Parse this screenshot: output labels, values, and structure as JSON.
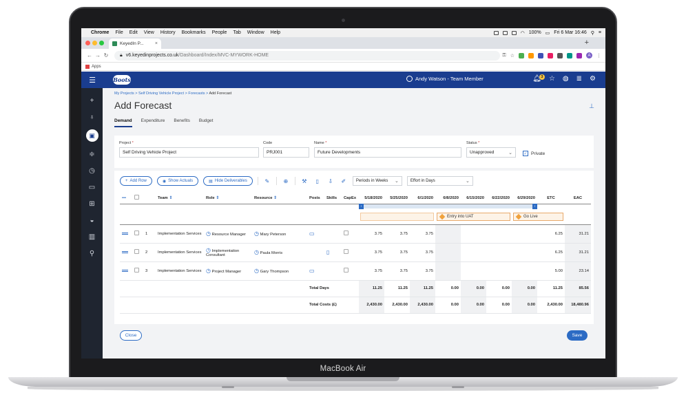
{
  "device_label": "MacBook Air",
  "menubar": {
    "items": [
      "Chrome",
      "File",
      "Edit",
      "View",
      "History",
      "Bookmarks",
      "People",
      "Tab",
      "Window",
      "Help"
    ],
    "battery": "100%",
    "clock": "Fri 6 Mar 16:46"
  },
  "browser": {
    "tab_title": "KeyedIn P...",
    "url_host": "v6.keyedinprojects.co.uk",
    "url_path": "/Dashboard/Index/MVC-MYWORK-HOME",
    "bookmark_apps": "Apps",
    "profile_initial": "A"
  },
  "header": {
    "logo": "Boots",
    "user": "Andy Watson - Team Member",
    "notification_count": "3"
  },
  "breadcrumb": {
    "items": [
      "My Projects",
      "Self Driving Vehicle Project",
      "Forecasts"
    ],
    "current": "Add Forecast"
  },
  "page_title": "Add Forecast",
  "tabs": [
    "Demand",
    "Expenditure",
    "Benefits",
    "Budget"
  ],
  "form": {
    "project_label": "Project",
    "project_value": "Self Driving Vehicle Project",
    "code_label": "Code",
    "code_value": "PRJ001",
    "name_label": "Name",
    "name_value": "Future Developments",
    "status_label": "Status",
    "status_value": "Unapproved",
    "private_label": "Private",
    "required_mark": "*",
    "check_mark": "✓"
  },
  "toolbar": {
    "add_row": "Add Row",
    "show_actuals": "Show Actuals",
    "hide_deliverables": "Hide Deliverables",
    "periods": "Periods in Weeks",
    "effort": "Effort in Days"
  },
  "grid": {
    "headers": {
      "team": "Team",
      "role": "Role",
      "resource": "Resource",
      "posts": "Posts",
      "skills": "Skills",
      "capex": "CapEx",
      "weeks": [
        "5/18/2020",
        "5/25/2020",
        "6/1/2020",
        "6/8/2020",
        "6/15/2020",
        "6/22/2020",
        "6/29/2020"
      ],
      "etc": "ETC",
      "eac": "EAC"
    },
    "milestones": [
      "Entry into UAT",
      "Go Live"
    ],
    "rows": [
      {
        "num": "1",
        "team": "Implementation Services",
        "role": "Resource Manager",
        "resource": "Mary Peterson",
        "weeks": [
          "3.75",
          "3.75",
          "3.75",
          "",
          "",
          "",
          ""
        ],
        "etc": "6.25",
        "eac": "31.21"
      },
      {
        "num": "2",
        "team": "Implementation Services",
        "role": "Implementation Consultant",
        "resource": "Paula Morris",
        "weeks": [
          "3.75",
          "3.75",
          "3.75",
          "",
          "",
          "",
          ""
        ],
        "etc": "6.25",
        "eac": "31.21"
      },
      {
        "num": "3",
        "team": "Implementation Services",
        "role": "Project Manager",
        "resource": "Gary Thompson",
        "weeks": [
          "3.75",
          "3.75",
          "3.75",
          "",
          "",
          "",
          ""
        ],
        "etc": "5.00",
        "eac": "23.14"
      }
    ],
    "total_days": {
      "label": "Total Days",
      "weeks": [
        "11.25",
        "11.25",
        "11.25",
        "0.00",
        "0.00",
        "0.00",
        "0.00"
      ],
      "etc": "11.25",
      "eac": "85.56"
    },
    "total_costs": {
      "label": "Total Costs (£)",
      "weeks": [
        "2,430.00",
        "2,430.00",
        "2,430.00",
        "0.00",
        "0.00",
        "0.00",
        "0.00"
      ],
      "etc": "2,430.00",
      "eac": "18,480.96"
    }
  },
  "footer": {
    "close": "Close",
    "save": "Save"
  },
  "colors": {
    "brand": "#1a3d8f",
    "accent": "#2c6bc4",
    "milestone": "#f0a23c"
  }
}
